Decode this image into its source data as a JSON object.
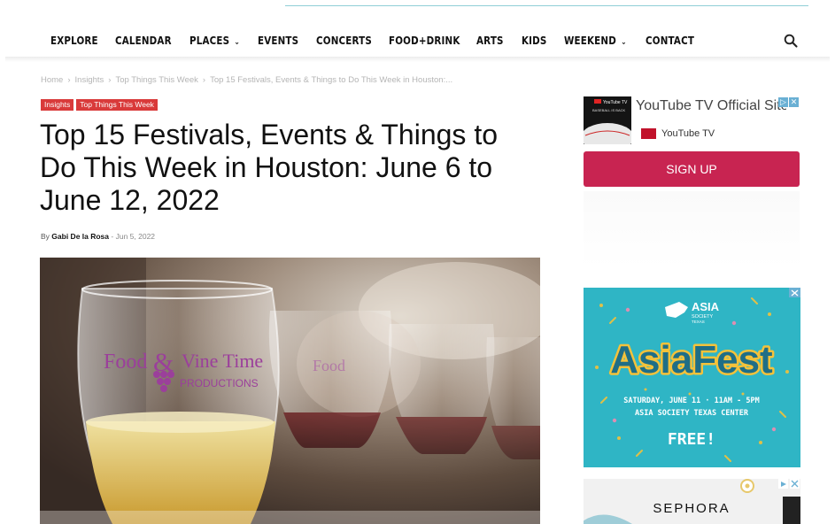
{
  "nav": {
    "items": [
      {
        "label": "EXPLORE",
        "dropdown": false
      },
      {
        "label": "CALENDAR",
        "dropdown": false
      },
      {
        "label": "PLACES",
        "dropdown": true
      },
      {
        "label": "EVENTS",
        "dropdown": false
      },
      {
        "label": "CONCERTS",
        "dropdown": false
      },
      {
        "label": "FOOD+DRINK",
        "dropdown": false
      },
      {
        "label": "ARTS",
        "dropdown": false
      },
      {
        "label": "KIDS",
        "dropdown": false
      },
      {
        "label": "WEEKEND",
        "dropdown": true
      },
      {
        "label": "CONTACT",
        "dropdown": false
      }
    ],
    "search_icon": "search-icon"
  },
  "breadcrumb": {
    "items": [
      "Home",
      "Insights",
      "Top Things This Week",
      "Top 15 Festivals, Events & Things to Do This Week in Houston:..."
    ],
    "separator": "›"
  },
  "article": {
    "tags": [
      "Insights",
      "Top Things This Week"
    ],
    "title": "Top 15 Festivals, Events & Things to Do This Week in Houston: June 6 to June 12, 2022",
    "byline_prefix": "By",
    "author": "Gabi De la Rosa",
    "date_separator": "-",
    "date": "Jun 5, 2022",
    "hero_text_1": "Food",
    "hero_text_2": "&",
    "hero_text_3": "Vine Time",
    "hero_text_4": "PRODUCTIONS"
  },
  "ads": {
    "youtube": {
      "title": "YouTube TV Official Site",
      "brand": "YouTube TV",
      "cta": "SIGN UP",
      "thumb_text": "YouTube TV",
      "thumb_sub": "BASEBALL IS BACK"
    },
    "asiafest": {
      "org_1": "ASIA",
      "org_2": "SOCIETY",
      "org_3": "TEXAS",
      "title": "AsiaFest",
      "date": "SATURDAY, JUNE 11 · 11AM - 5PM",
      "venue": "ASIA SOCIETY TEXAS CENTER",
      "price": "FREE!"
    },
    "sephora": {
      "brand": "SEPHORA"
    }
  },
  "colors": {
    "tag_red": "#d93a3a",
    "signup": "#c82451",
    "asiafest_bg": "#2fb5c5",
    "accent_line": "#8fcfd6"
  }
}
